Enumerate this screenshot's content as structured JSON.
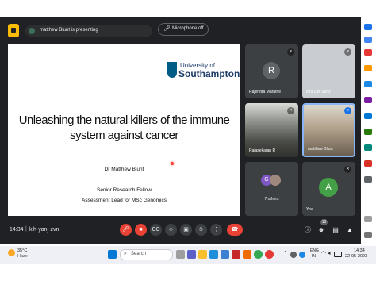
{
  "meet": {
    "presenting_label": "matthew Blunt is presenting",
    "mic_status": "Microphone off",
    "slide": {
      "university_line1": "University of",
      "university_line2": "Southampton",
      "title": "Unleashing the natural killers of the immune system against cancer",
      "author": "Dr Matthew Blunt",
      "role1": "Senior Research Fellow",
      "role2": "Assessment Lead for MSc Genomics"
    },
    "participants": [
      {
        "name": "Rajendra Marathe",
        "initial": "R"
      },
      {
        "name": "Info Life Senz"
      },
      {
        "name": "Rajasekaran R"
      },
      {
        "name": "matthew Blunt"
      },
      {
        "name": "7 others",
        "initial": "G"
      },
      {
        "name": "You",
        "initial": "A"
      }
    ],
    "time": "14:34",
    "meeting_code": "kih-yanj-zvn",
    "participant_count": "13",
    "colors": {
      "end_call": "#ea4335",
      "active_speaker": "#8ab4f8"
    }
  },
  "taskbar": {
    "weather_temp": "35°C",
    "weather_desc": "Haze",
    "search_placeholder": "Search",
    "lang1": "ENG",
    "lang2": "IN",
    "clock_time": "14:34",
    "clock_date": "22-05-2023"
  }
}
